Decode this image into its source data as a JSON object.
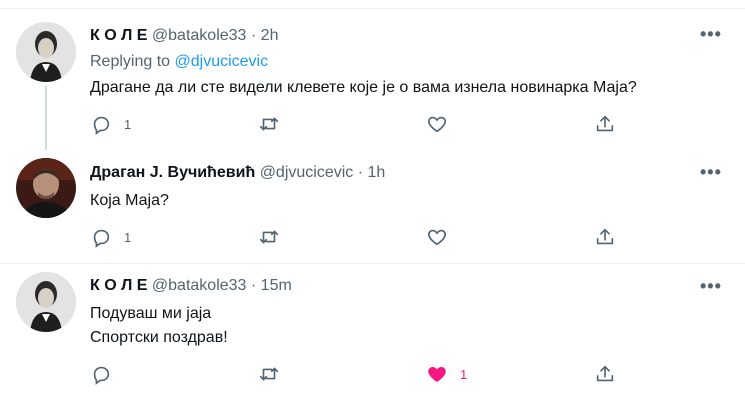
{
  "tweets": [
    {
      "name": "К О Л Е",
      "handle": "@batakole33",
      "dot": "·",
      "time": "2h",
      "replying_prefix": "Replying to",
      "replying_mention": "@djvucicevic",
      "lines": [
        "Драгане да ли сте видели клевете које је о вама изнела новинарка Маја?"
      ],
      "reply_count": "1",
      "retweet_count": "",
      "like_count": ""
    },
    {
      "name": "Драган Ј. Вучићевић",
      "handle": "@djvucicevic",
      "dot": "·",
      "time": "1h",
      "lines": [
        "Која Маја?"
      ],
      "reply_count": "1",
      "retweet_count": "",
      "like_count": ""
    },
    {
      "name": "К О Л Е",
      "handle": "@batakole33",
      "dot": "·",
      "time": "15m",
      "lines": [
        "Подуваш ми јаја",
        "Спортски поздрав!"
      ],
      "reply_count": "",
      "retweet_count": "",
      "like_count": "1",
      "liked": true
    }
  ],
  "icons": {
    "reply": "reply-icon",
    "retweet": "retweet-icon",
    "like": "heart-icon",
    "share": "share-icon",
    "more": "more-icon"
  },
  "colors": {
    "muted": "#536471",
    "link": "#1d9bf0",
    "liked": "#f91880",
    "thread_line": "#cfd9de"
  },
  "more_label": "•••"
}
